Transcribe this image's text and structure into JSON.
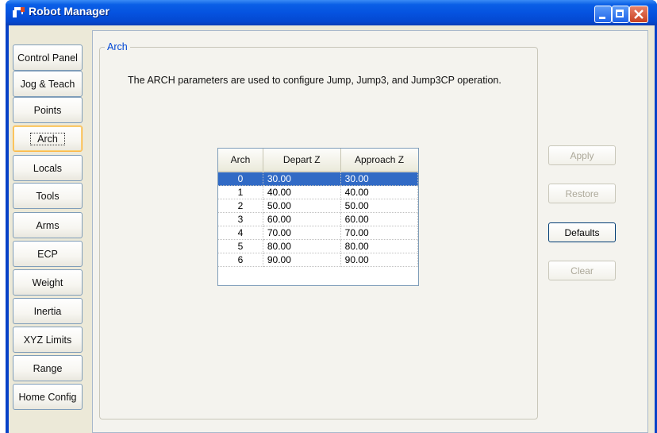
{
  "window": {
    "title": "Robot Manager"
  },
  "nav": {
    "items": [
      {
        "label": "Control Panel"
      },
      {
        "label": "Jog & Teach"
      },
      {
        "label": "Points"
      },
      {
        "label": "Arch"
      },
      {
        "label": "Locals"
      },
      {
        "label": "Tools"
      },
      {
        "label": "Arms"
      },
      {
        "label": "ECP"
      },
      {
        "label": "Weight"
      },
      {
        "label": "Inertia"
      },
      {
        "label": "XYZ Limits"
      },
      {
        "label": "Range"
      },
      {
        "label": "Home Config"
      }
    ],
    "active": "Arch"
  },
  "group": {
    "title": "Arch",
    "description": "The ARCH parameters are used to configure Jump, Jump3, and Jump3CP operation."
  },
  "table": {
    "columns": [
      "Arch",
      "Depart Z",
      "Approach Z"
    ],
    "rows": [
      [
        "0",
        "30.00",
        "30.00"
      ],
      [
        "1",
        "40.00",
        "40.00"
      ],
      [
        "2",
        "50.00",
        "50.00"
      ],
      [
        "3",
        "60.00",
        "60.00"
      ],
      [
        "4",
        "70.00",
        "70.00"
      ],
      [
        "5",
        "80.00",
        "80.00"
      ],
      [
        "6",
        "90.00",
        "90.00"
      ]
    ],
    "selected_row": 0
  },
  "actions": {
    "apply": "Apply",
    "restore": "Restore",
    "defaults": "Defaults",
    "clear": "Clear"
  },
  "colors": {
    "titlebar": "#0553e0",
    "selection": "#316ac5",
    "group_title": "#0046d5",
    "active_nav_border": "#ffb53c"
  }
}
